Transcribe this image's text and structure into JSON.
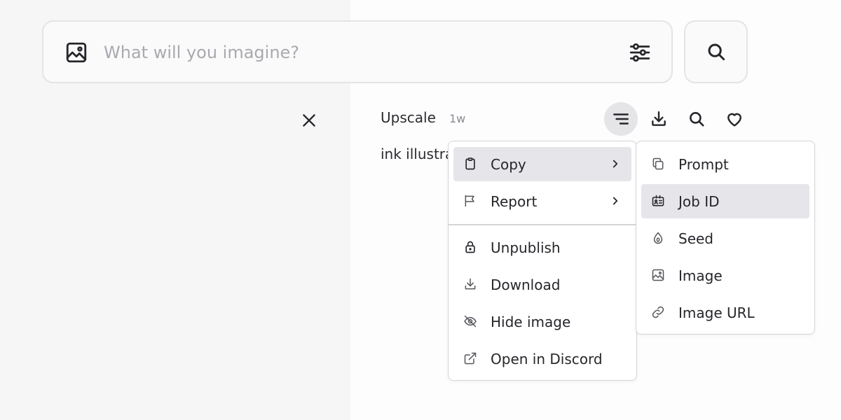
{
  "search": {
    "placeholder": "What will you imagine?"
  },
  "job": {
    "label": "Upscale",
    "age": "1w",
    "prompt_preview": "ink illustra"
  },
  "context_menu": {
    "items": [
      {
        "label": "Copy",
        "icon": "clipboard-icon",
        "has_submenu": true
      },
      {
        "label": "Report",
        "icon": "flag-icon",
        "has_submenu": true
      },
      {
        "label": "Unpublish",
        "icon": "lock-icon"
      },
      {
        "label": "Download",
        "icon": "download-icon"
      },
      {
        "label": "Hide image",
        "icon": "eye-off-icon"
      },
      {
        "label": "Open in Discord",
        "icon": "external-link-icon"
      }
    ]
  },
  "copy_submenu": {
    "items": [
      {
        "label": "Prompt",
        "icon": "copy-icon"
      },
      {
        "label": "Job ID",
        "icon": "id-card-icon"
      },
      {
        "label": "Seed",
        "icon": "seed-icon"
      },
      {
        "label": "Image",
        "icon": "image-icon"
      },
      {
        "label": "Image URL",
        "icon": "link-icon"
      }
    ]
  },
  "colors": {
    "left_panel": "#f6f6f7",
    "highlight": "#e6e6ea",
    "border": "#d4d4d8",
    "text": "#26262b"
  }
}
